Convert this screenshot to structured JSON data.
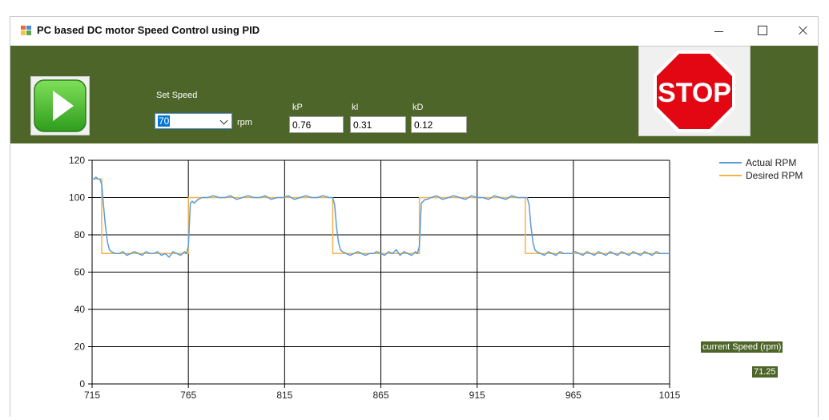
{
  "window": {
    "title": "PC based DC motor Speed Control  using PID",
    "app_icon": "winforms-app-icon"
  },
  "window_controls": [
    "minimize-icon",
    "maximize-icon",
    "close-icon"
  ],
  "controls": {
    "play_icon": "play-icon",
    "set_speed_label": "Set Speed",
    "speed_value": "70",
    "speed_unit": "rpm",
    "kp_label": "kP",
    "kp_value": "0.76",
    "ki_label": "kI",
    "ki_value": "0.31",
    "kd_label": "kD",
    "kd_value": "0.12",
    "stop_text": "STOP"
  },
  "status": {
    "current_speed_label": "current Speed (rpm)",
    "current_speed_value": "71.25"
  },
  "colors": {
    "panel": "#4d6528",
    "actual": "#5b9bd5",
    "desired": "#f4b34a",
    "stop_sign": "#e30613"
  },
  "chart_data": {
    "type": "line",
    "x_ticks": [
      "715",
      "765",
      "815",
      "865",
      "915",
      "965",
      "1015"
    ],
    "y_ticks": [
      "0",
      "20",
      "40",
      "60",
      "80",
      "100",
      "120"
    ],
    "xlim": [
      715,
      1015
    ],
    "ylim": [
      0,
      120
    ],
    "grid": true,
    "legend": "top-right",
    "series": [
      {
        "name": "Actual RPM",
        "color": "#5b9bd5",
        "points": [
          [
            715,
            110
          ],
          [
            716,
            110
          ],
          [
            717,
            111
          ],
          [
            718,
            110
          ],
          [
            719,
            110
          ],
          [
            720,
            107
          ],
          [
            721,
            95
          ],
          [
            722,
            84
          ],
          [
            723,
            76
          ],
          [
            724,
            72
          ],
          [
            725,
            71
          ],
          [
            727,
            70
          ],
          [
            729,
            70
          ],
          [
            731,
            71
          ],
          [
            733,
            69
          ],
          [
            735,
            70
          ],
          [
            737,
            71
          ],
          [
            739,
            70
          ],
          [
            741,
            69
          ],
          [
            743,
            71
          ],
          [
            745,
            70
          ],
          [
            747,
            70
          ],
          [
            749,
            71
          ],
          [
            751,
            69
          ],
          [
            753,
            70
          ],
          [
            755,
            68
          ],
          [
            757,
            71
          ],
          [
            759,
            70
          ],
          [
            761,
            69
          ],
          [
            763,
            71
          ],
          [
            764,
            70
          ],
          [
            765,
            74
          ],
          [
            766,
            97
          ],
          [
            767,
            98
          ],
          [
            768,
            97
          ],
          [
            769,
            98
          ],
          [
            770,
            99
          ],
          [
            772,
            100
          ],
          [
            775,
            100
          ],
          [
            778,
            101
          ],
          [
            781,
            100
          ],
          [
            784,
            100
          ],
          [
            787,
            101
          ],
          [
            790,
            99
          ],
          [
            793,
            100
          ],
          [
            796,
            101
          ],
          [
            799,
            100
          ],
          [
            802,
            100
          ],
          [
            805,
            101
          ],
          [
            808,
            99
          ],
          [
            811,
            100
          ],
          [
            814,
            100
          ],
          [
            817,
            101
          ],
          [
            820,
            99
          ],
          [
            823,
            100
          ],
          [
            826,
            101
          ],
          [
            829,
            100
          ],
          [
            832,
            100
          ],
          [
            835,
            101
          ],
          [
            838,
            100
          ],
          [
            840,
            100
          ],
          [
            841,
            96
          ],
          [
            842,
            84
          ],
          [
            843,
            76
          ],
          [
            844,
            72
          ],
          [
            845,
            71
          ],
          [
            847,
            70
          ],
          [
            849,
            69
          ],
          [
            851,
            70
          ],
          [
            853,
            71
          ],
          [
            855,
            70
          ],
          [
            857,
            69
          ],
          [
            859,
            70
          ],
          [
            861,
            70
          ],
          [
            863,
            71
          ],
          [
            865,
            70
          ],
          [
            867,
            69
          ],
          [
            869,
            71
          ],
          [
            871,
            70
          ],
          [
            873,
            72
          ],
          [
            875,
            69
          ],
          [
            877,
            71
          ],
          [
            879,
            70
          ],
          [
            881,
            69
          ],
          [
            883,
            71
          ],
          [
            884,
            70
          ],
          [
            885,
            74
          ],
          [
            886,
            97
          ],
          [
            887,
            98
          ],
          [
            888,
            99
          ],
          [
            889,
            99
          ],
          [
            891,
            100
          ],
          [
            894,
            101
          ],
          [
            897,
            99
          ],
          [
            900,
            100
          ],
          [
            903,
            101
          ],
          [
            906,
            100
          ],
          [
            909,
            99
          ],
          [
            912,
            101
          ],
          [
            915,
            100
          ],
          [
            918,
            100
          ],
          [
            921,
            99
          ],
          [
            924,
            101
          ],
          [
            927,
            100
          ],
          [
            930,
            99
          ],
          [
            933,
            101
          ],
          [
            936,
            100
          ],
          [
            939,
            100
          ],
          [
            941,
            100
          ],
          [
            942,
            96
          ],
          [
            943,
            84
          ],
          [
            944,
            76
          ],
          [
            945,
            72
          ],
          [
            946,
            71
          ],
          [
            948,
            70
          ],
          [
            950,
            69
          ],
          [
            952,
            71
          ],
          [
            954,
            70
          ],
          [
            956,
            69
          ],
          [
            958,
            71
          ],
          [
            960,
            70
          ],
          [
            962,
            70
          ],
          [
            964,
            70
          ],
          [
            966,
            71
          ],
          [
            968,
            70
          ],
          [
            970,
            69
          ],
          [
            972,
            71
          ],
          [
            974,
            70
          ],
          [
            976,
            69
          ],
          [
            978,
            71
          ],
          [
            980,
            70
          ],
          [
            982,
            69
          ],
          [
            984,
            71
          ],
          [
            986,
            70
          ],
          [
            988,
            69
          ],
          [
            990,
            71
          ],
          [
            992,
            70
          ],
          [
            994,
            69
          ],
          [
            996,
            71
          ],
          [
            998,
            70
          ],
          [
            1000,
            69
          ],
          [
            1002,
            71
          ],
          [
            1004,
            70
          ],
          [
            1006,
            69
          ],
          [
            1008,
            71
          ],
          [
            1010,
            70
          ],
          [
            1012,
            70
          ],
          [
            1014,
            70
          ],
          [
            1015,
            70
          ]
        ]
      },
      {
        "name": "Desired RPM",
        "color": "#f4b34a",
        "points": [
          [
            715,
            110
          ],
          [
            720,
            110
          ],
          [
            720,
            70
          ],
          [
            765,
            70
          ],
          [
            765,
            100
          ],
          [
            840,
            100
          ],
          [
            840,
            70
          ],
          [
            885,
            70
          ],
          [
            885,
            100
          ],
          [
            940,
            100
          ],
          [
            940,
            70
          ],
          [
            1015,
            70
          ]
        ]
      }
    ]
  }
}
